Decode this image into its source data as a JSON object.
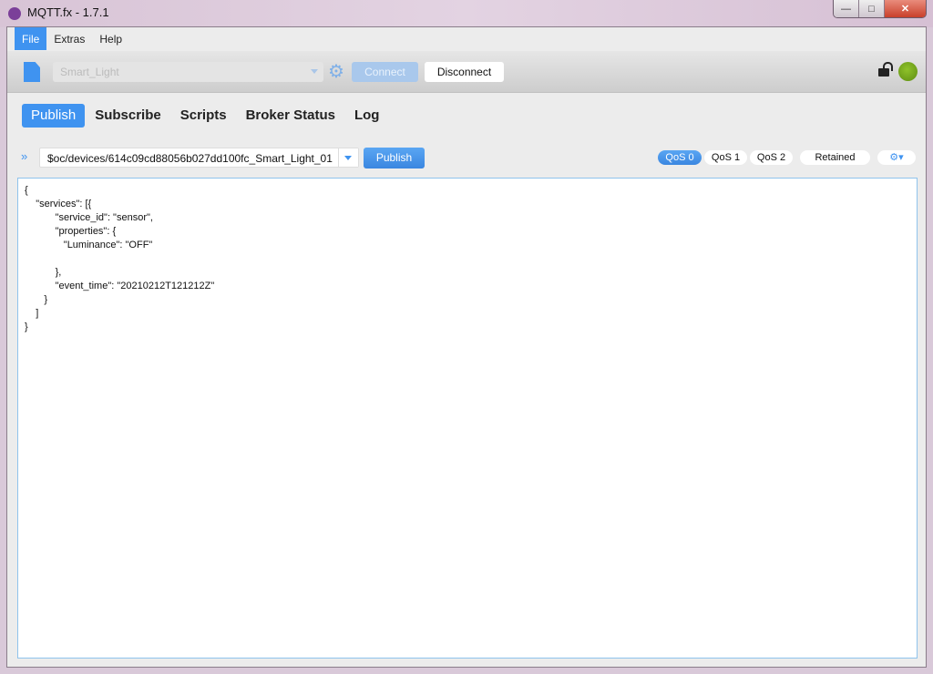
{
  "window": {
    "title": "MQTT.fx - 1.7.1",
    "minimize": "—",
    "maximize": "□",
    "close": "✕"
  },
  "menu": [
    {
      "label": "File",
      "active": true
    },
    {
      "label": "Extras"
    },
    {
      "label": "Help"
    }
  ],
  "toolbar": {
    "profile_value": "Smart_Light",
    "connect_label": "Connect",
    "disconnect_label": "Disconnect",
    "gear_glyph": "⚙",
    "connection_status_color": "#7aab1e",
    "connected": true
  },
  "tabs": [
    {
      "label": "Publish",
      "active": true
    },
    {
      "label": "Subscribe"
    },
    {
      "label": "Scripts"
    },
    {
      "label": "Broker Status"
    },
    {
      "label": "Log"
    }
  ],
  "publish": {
    "expand_glyph": "»",
    "topic": "$oc/devices/614c09cd88056b027dd100fc_Smart_Light_01",
    "publish_label": "Publish",
    "qos": [
      {
        "label": "QoS 0",
        "active": true
      },
      {
        "label": "QoS 1"
      },
      {
        "label": "QoS 2"
      }
    ],
    "retained_label": "Retained",
    "options_glyph": "⚙▾",
    "payload_lines": [
      "{",
      "    \"services\": [{",
      "           \"service_id\": \"sensor\",",
      "           \"properties\": {",
      "              \"Luminance\": \"OFF\"",
      "",
      "           },",
      "           \"event_time\": \"20210212T121212Z\"",
      "       }",
      "    ]",
      "}"
    ]
  },
  "colors": {
    "accent": "#3f93f0"
  }
}
